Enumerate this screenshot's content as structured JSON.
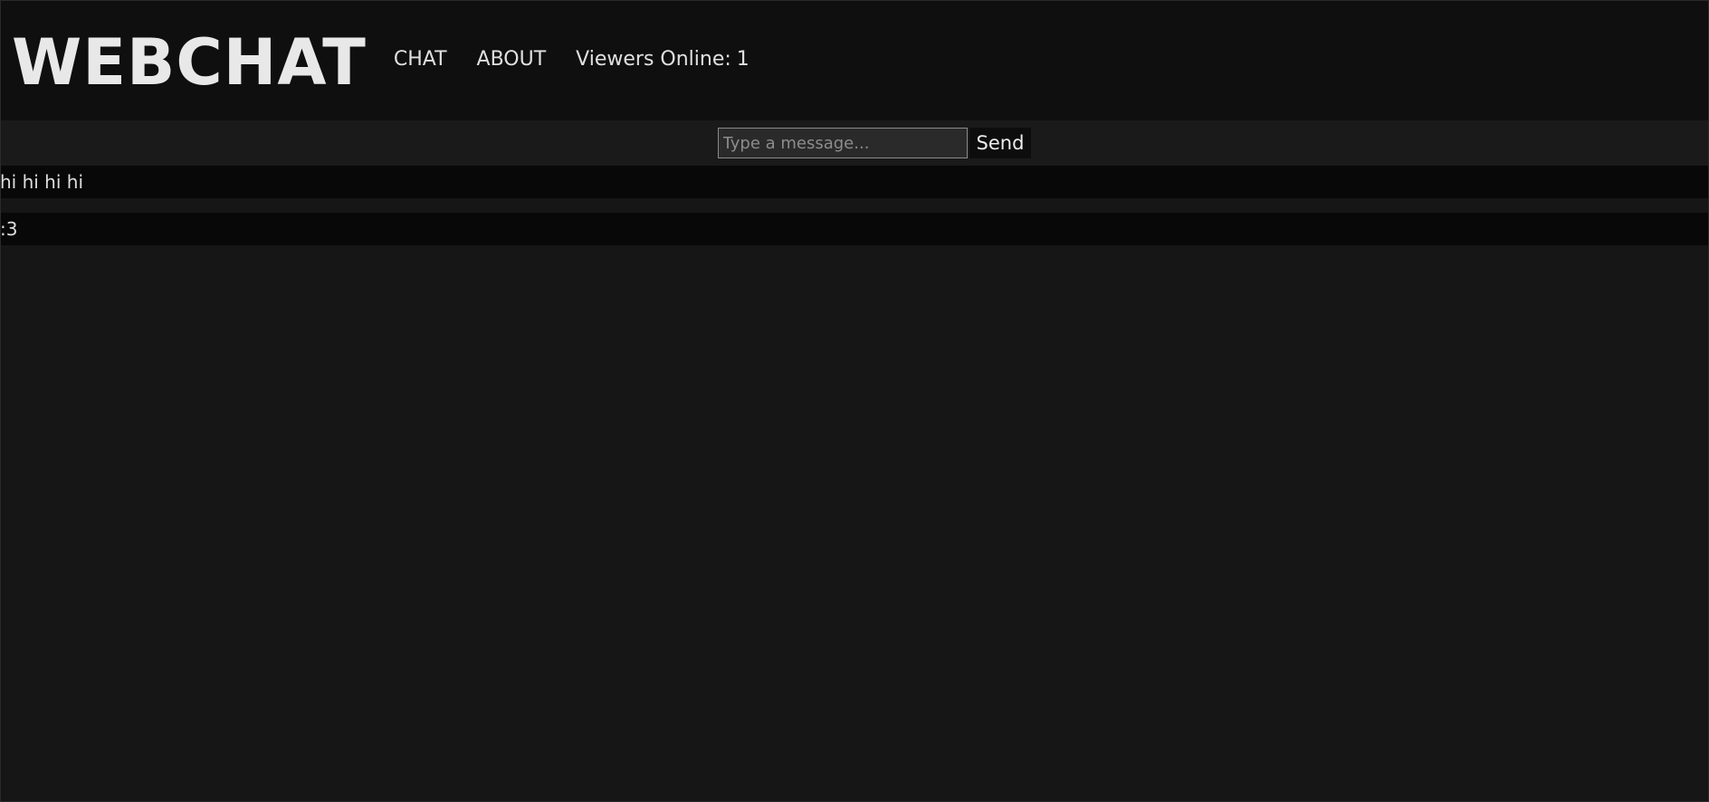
{
  "header": {
    "logo": "WEBCHAT",
    "nav": [
      {
        "label": "CHAT"
      },
      {
        "label": "ABOUT"
      }
    ],
    "viewers_label": "Viewers Online:",
    "viewers_count": "1"
  },
  "composer": {
    "placeholder": "Type a message...",
    "send_label": "Send"
  },
  "messages": [
    {
      "text": "hi hi hi hi"
    },
    {
      "text": ":3"
    }
  ]
}
